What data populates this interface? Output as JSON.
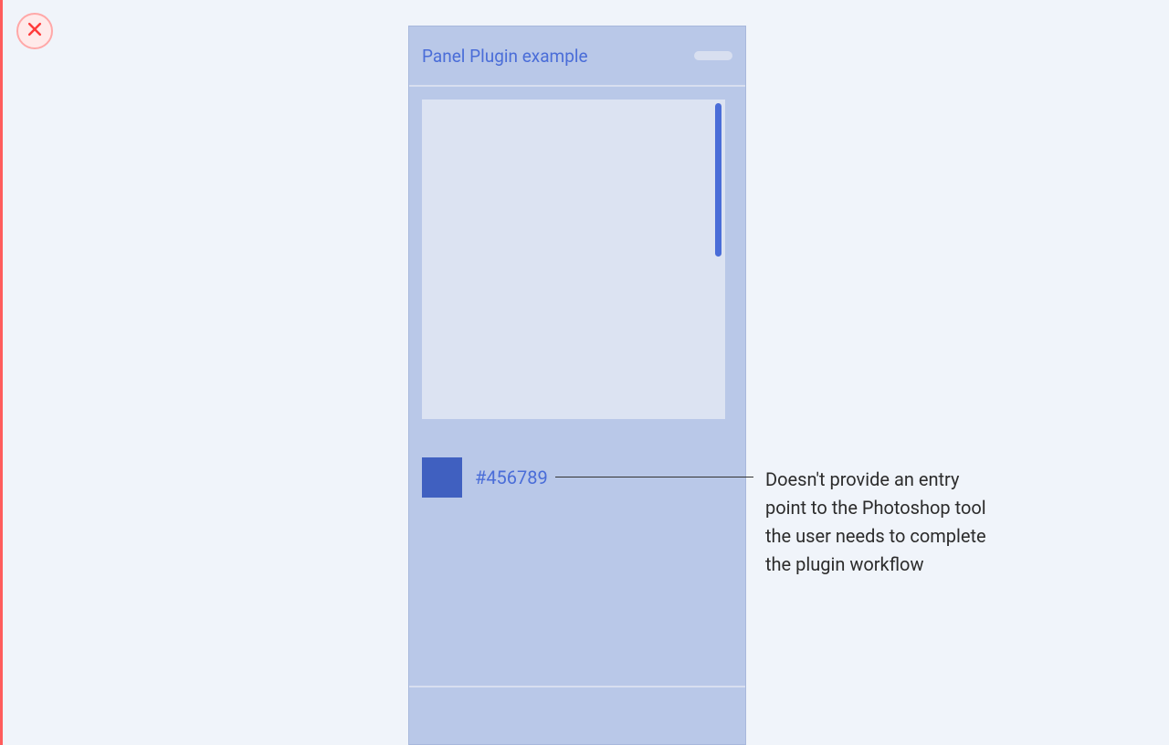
{
  "panel": {
    "title": "Panel Plugin example",
    "color_value": "#456789"
  },
  "annotation": {
    "text": "Doesn't provide an entry point to the Photoshop tool the user needs to complete the plugin workflow"
  }
}
